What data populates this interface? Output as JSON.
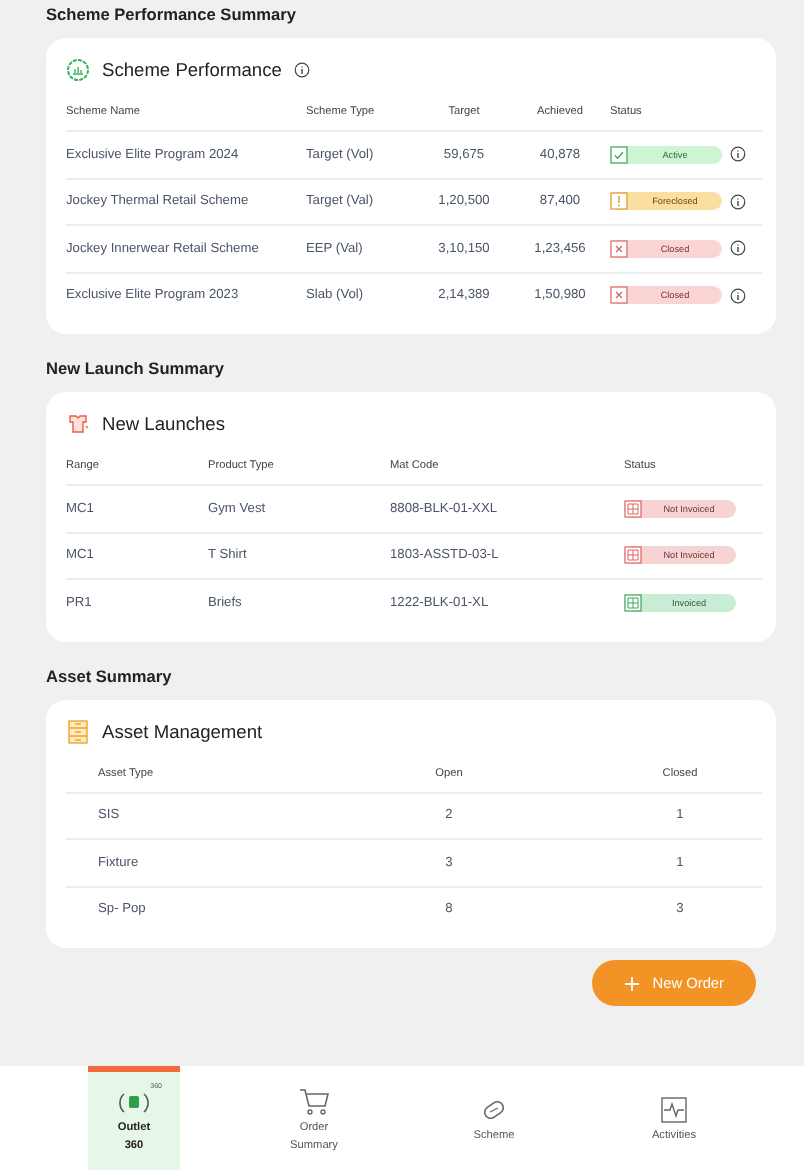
{
  "scheme_section": {
    "heading": "Scheme Performance Summary",
    "card_title": "Scheme Performance",
    "columns": [
      "Scheme Name",
      "Scheme Type",
      "Target",
      "Achieved",
      "Status"
    ],
    "rows": [
      {
        "name": "Exclusive Elite Program 2024",
        "type": "Target (Vol)",
        "target": "59,675",
        "achieved": "40,878",
        "status": "Active",
        "kind": "active"
      },
      {
        "name": "Jockey Thermal Retail Scheme",
        "type": "Target (Val)",
        "target": "1,20,500",
        "achieved": "87,400",
        "status": "Foreclosed",
        "kind": "foreclosed"
      },
      {
        "name": "Jockey Innerwear Retail Scheme",
        "type": "EEP (Val)",
        "target": "3,10,150",
        "achieved": "1,23,456",
        "status": "Closed",
        "kind": "closed"
      },
      {
        "name": "Exclusive Elite Program 2023",
        "type": "Slab (Vol)",
        "target": "2,14,389",
        "achieved": "1,50,980",
        "status": "Closed",
        "kind": "closed"
      }
    ]
  },
  "launch_section": {
    "heading": "New Launch Summary",
    "card_title": "New Launches",
    "columns": [
      "Range",
      "Product Type",
      "Mat Code",
      "Status"
    ],
    "rows": [
      {
        "range": "MC1",
        "product_type": "Gym Vest",
        "mat_code": "8808-BLK-01-XXL",
        "status": "Not Invoiced",
        "kind": "not_invoiced"
      },
      {
        "range": "MC1",
        "product_type": "T Shirt",
        "mat_code": "1803-ASSTD-03-L",
        "status": "Not Invoiced",
        "kind": "not_invoiced"
      },
      {
        "range": "PR1",
        "product_type": "Briefs",
        "mat_code": "1222-BLK-01-XL",
        "status": "Invoiced",
        "kind": "invoiced"
      }
    ]
  },
  "asset_section": {
    "heading": "Asset Summary",
    "card_title": "Asset Management",
    "columns": [
      "Asset Type",
      "Open",
      "Closed"
    ],
    "rows": [
      {
        "type": "SIS",
        "open": "2",
        "closed": "1"
      },
      {
        "type": "Fixture",
        "open": "3",
        "closed": "1"
      },
      {
        "type": "Sp- Pop",
        "open": "8",
        "closed": "3"
      }
    ]
  },
  "new_order_button": {
    "label": "New Order"
  },
  "bottom_nav": [
    {
      "label": "Outlet\n360",
      "kind": "outlet",
      "icon_text": "360",
      "selected": true
    },
    {
      "label": "Order\nSummary",
      "kind": "cart",
      "selected": false
    },
    {
      "label": "Scheme",
      "kind": "tag",
      "selected": false
    },
    {
      "label": "Activities",
      "kind": "activity",
      "selected": false
    }
  ]
}
